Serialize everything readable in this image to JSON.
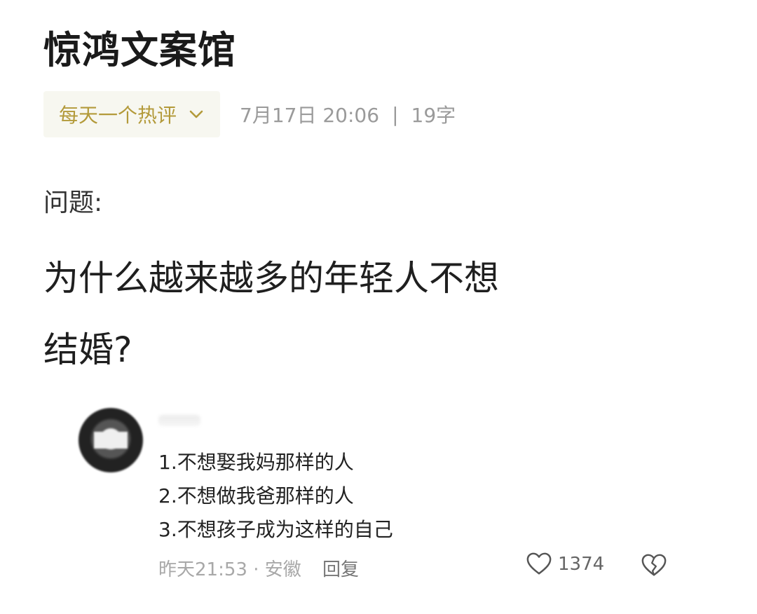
{
  "header": {
    "title": "惊鸿文案馆"
  },
  "meta": {
    "collection": "每天一个热评",
    "date": "7月17日 20:06",
    "separator": "|",
    "word_count": "19字"
  },
  "post": {
    "question_label": "问题:",
    "question_line1": "为什么越来越多的年轻人不想",
    "question_line2": "结婚?"
  },
  "comment": {
    "lines": [
      "1.不想娶我妈那样的人",
      "2.不想做我爸那样的人",
      "3.不想孩子成为这样的自己"
    ],
    "time_location": "昨天21:53 · 安徽",
    "reply_label": "回复",
    "like_count": "1374"
  },
  "colors": {
    "accent": "#b39a3a",
    "muted": "#9a9a9a"
  },
  "icons": {
    "chevron": "chevron-down-icon",
    "like": "heart-icon",
    "dislike": "broken-heart-icon"
  }
}
